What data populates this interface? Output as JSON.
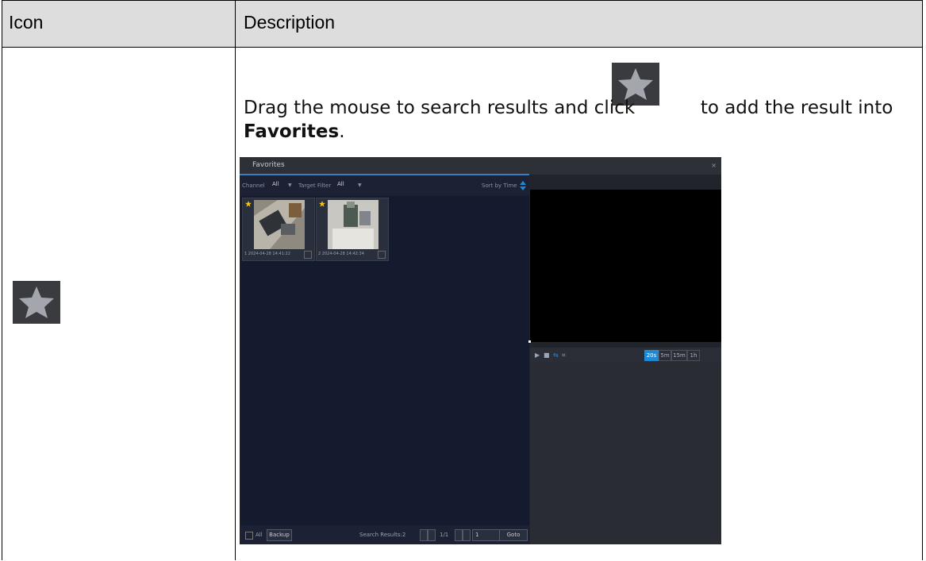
{
  "table": {
    "header": {
      "icon": "Icon",
      "description": "Description"
    },
    "row": {
      "icon_name": "star-icon",
      "text_before": "Drag the mouse to search results and click",
      "text_after": "to add the result into",
      "bold_term": "Favorites",
      "period": "."
    }
  },
  "screenshot": {
    "title": "Favorites",
    "close": "×",
    "filter": {
      "channel_label": "Channel",
      "channel_value": "All",
      "target_label": "Target Filter",
      "target_value": "All",
      "sort_label": "Sort by Time"
    },
    "thumbnails": [
      {
        "caption": "1 2024-04-28 14:41:22"
      },
      {
        "caption": "2 2024-04-28 14:42:34"
      }
    ],
    "bottom": {
      "all_label": "All",
      "backup_label": "Backup",
      "results_label": "Search Results:2",
      "page_label": "1/1",
      "page_input": "1",
      "goto_label": "Goto"
    },
    "time_buttons": [
      "20s",
      "5m",
      "15m",
      "1h"
    ],
    "selected_time": "20s",
    "colors": {
      "accent": "#1e8ad6",
      "star": "#f5c518"
    }
  }
}
